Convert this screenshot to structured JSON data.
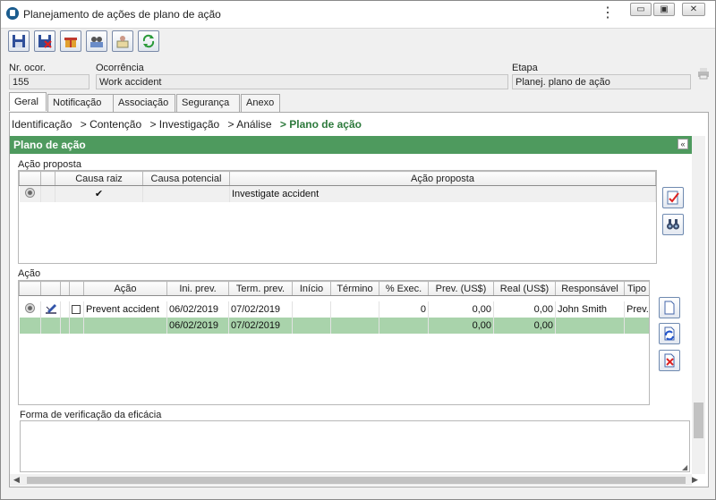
{
  "window": {
    "title": "Planejamento de ações de plano de ação"
  },
  "header": {
    "nr_label": "Nr. ocor.",
    "nr_value": "155",
    "occ_label": "Ocorrência",
    "occ_value": "Work accident",
    "stage_label": "Etapa",
    "stage_value": "Planej. plano de ação"
  },
  "tabs": [
    "Geral",
    "Notificação",
    "Associação",
    "Segurança",
    "Anexo"
  ],
  "breadcrumb": {
    "items": [
      "Identificação",
      "> Contenção",
      "> Investigação",
      "> Análise"
    ],
    "current": "> Plano de ação"
  },
  "section": {
    "title": "Plano de ação"
  },
  "proposed": {
    "label": "Ação proposta",
    "headers": [
      "Causa raiz",
      "Causa potencial",
      "Ação proposta"
    ],
    "rows": [
      {
        "root_cause": "✔",
        "potential_cause": "",
        "action": "Investigate accident"
      }
    ]
  },
  "actions": {
    "label": "Ação",
    "headers": [
      "Ação",
      "Ini. prev.",
      "Term. prev.",
      "Início",
      "Término",
      "% Exec.",
      "Prev. (US$)",
      "Real (US$)",
      "Responsável",
      "Tipo"
    ],
    "row": {
      "action": "Prevent accident",
      "ini": "06/02/2019",
      "term": "07/02/2019",
      "start": "",
      "end": "",
      "exec": "0",
      "prev": "0,00",
      "real": "0,00",
      "resp": "John Smith",
      "type": "Prev."
    },
    "total": {
      "ini": "06/02/2019",
      "term": "07/02/2019",
      "prev": "0,00",
      "real": "0,00"
    }
  },
  "efficacy": {
    "label": "Forma de verificação da eficácia",
    "value": ""
  },
  "colors": {
    "section": "#4e9a5e",
    "selected_row": "#a9d3ab",
    "current_step": "#2d7a3c"
  }
}
